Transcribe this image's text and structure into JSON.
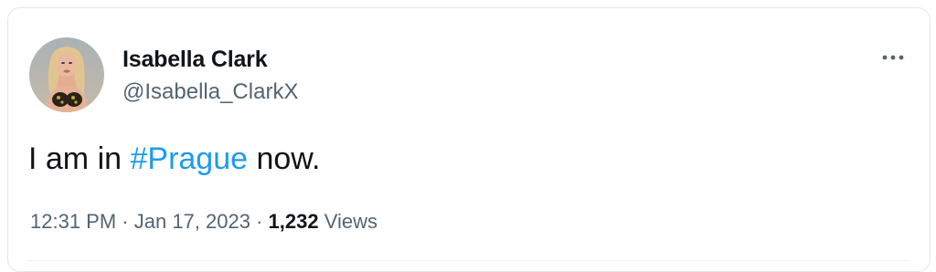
{
  "author": {
    "display_name": "Isabella Clark",
    "handle": "@Isabella_ClarkX",
    "avatar_icon": "profile-photo"
  },
  "menu": {
    "icon": "more-horizontal-icon"
  },
  "tweet": {
    "text_before": "I am in ",
    "hashtag": "#Prague",
    "text_after": " now."
  },
  "meta": {
    "time": "12:31 PM",
    "separator1": " · ",
    "date": "Jan 17, 2023",
    "separator2": " · ",
    "view_count": "1,232",
    "views_label": " Views"
  },
  "colors": {
    "text": "#0f1419",
    "secondary": "#536471",
    "link": "#1d9bf0",
    "border": "#e3e6e8"
  }
}
